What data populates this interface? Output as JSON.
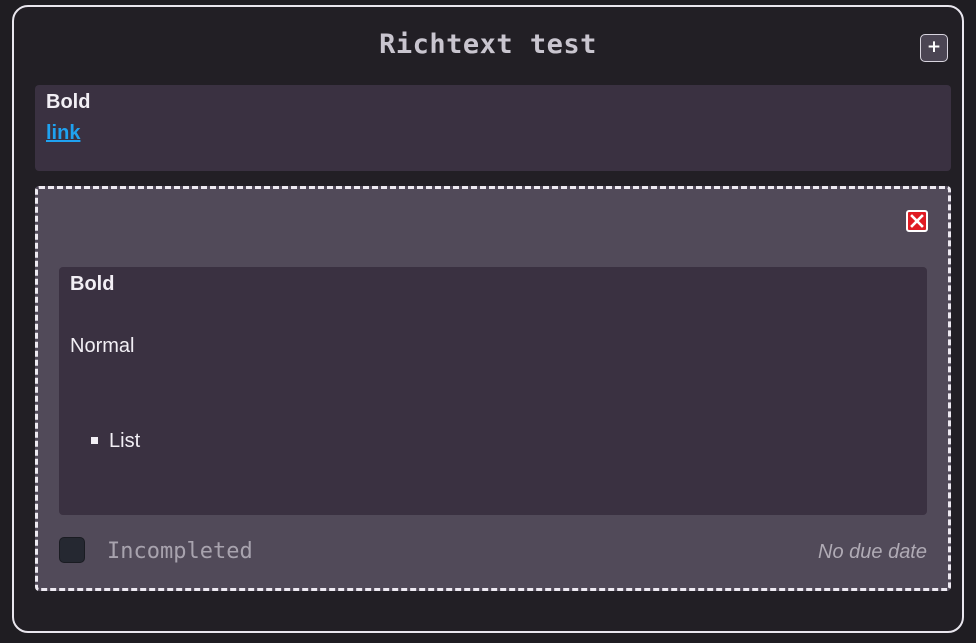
{
  "header": {
    "title": "Richtext test",
    "add_button_label": "+"
  },
  "description": {
    "bold_text": "Bold",
    "link_text": "link"
  },
  "task": {
    "delete_icon": "close-icon",
    "content": {
      "bold_text": "Bold",
      "normal_text": "Normal",
      "list_items": [
        "List"
      ]
    },
    "completed": false,
    "status_label": "Incompleted",
    "due_date_label": "No due date"
  },
  "colors": {
    "background": "#1f1d22",
    "card": "#514a59",
    "text_box": "#3a3141",
    "link": "#1fa2f0",
    "delete": "#e01c24"
  }
}
